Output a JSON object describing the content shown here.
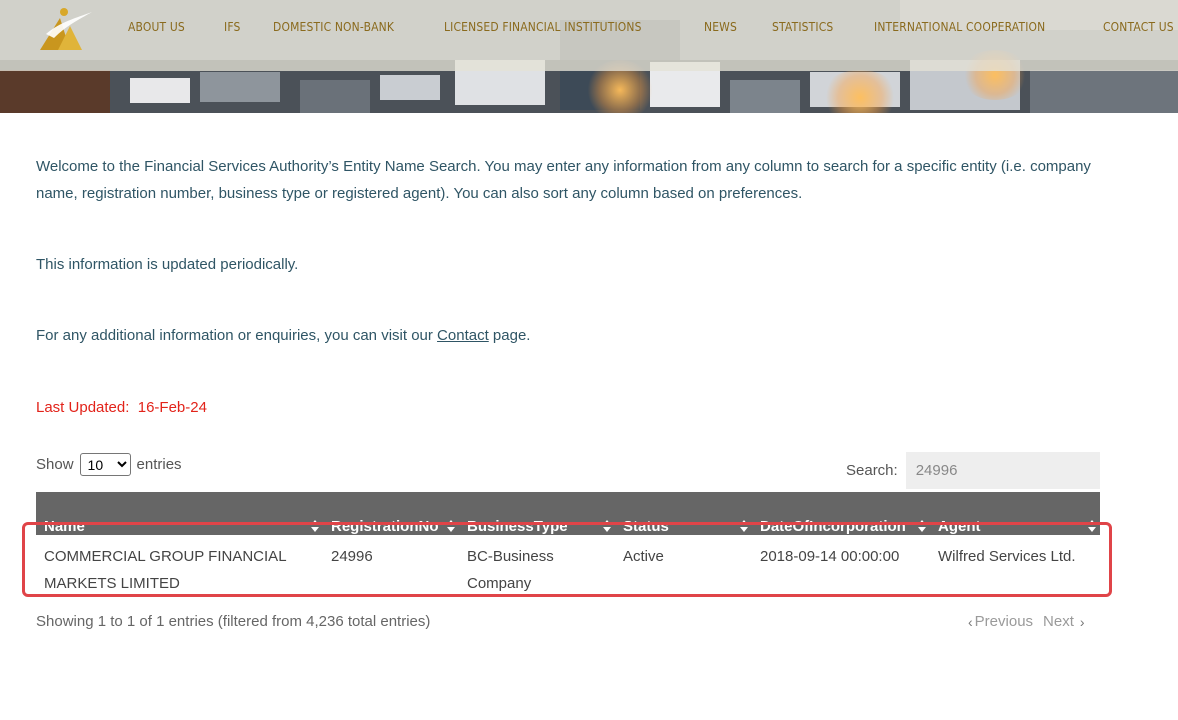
{
  "nav": {
    "items": [
      "ABOUT US",
      "IFS",
      "DOMESTIC NON-BANK",
      "LICENSED FINANCIAL INSTITUTIONS",
      "NEWS",
      "STATISTICS",
      "INTERNATIONAL COOPERATION",
      "CONTACT US"
    ]
  },
  "intro": {
    "paragraph1": "Welcome to the Financial Services Authority’s Entity Name Search. You may enter any information from any column to search for a specific entity (i.e. company name, registration number, business type or registered agent). You can also sort any column based on preferences.",
    "paragraph2": "This information is updated periodically.",
    "paragraph3_prefix": "For any additional information or enquiries, you can visit our",
    "contact_link": "Contact",
    "paragraph3_suffix": "page.",
    "last_updated_label": "Last Updated:",
    "last_updated_value": "16-Feb-24"
  },
  "controls": {
    "show_label": "Show",
    "entries_label": "entries",
    "page_size": "10",
    "search_label": "Search:",
    "search_value": "24996"
  },
  "table": {
    "columns": [
      "Name",
      "RegistrationNo",
      "BusinessType",
      "Status",
      "DateOfIncorporation",
      "Agent"
    ],
    "rows": [
      {
        "name": "COMMERCIAL GROUP FINANCIAL MARKETS LIMITED",
        "registration_no": "24996",
        "business_type": "BC-Business Company",
        "status": "Active",
        "date_of_incorporation": "2018-09-14 00:00:00",
        "agent": "Wilfred Services Ltd."
      }
    ]
  },
  "footer": {
    "info": "Showing 1 to 1 of 1 entries (filtered from 4,236 total entries)",
    "previous": "Previous",
    "next": "Next"
  },
  "colors": {
    "nav_text": "#8a6a1d",
    "link_text": "#2f5565",
    "last_updated": "#e2231a",
    "table_header": "#666666",
    "highlight_border": "#e04448"
  }
}
